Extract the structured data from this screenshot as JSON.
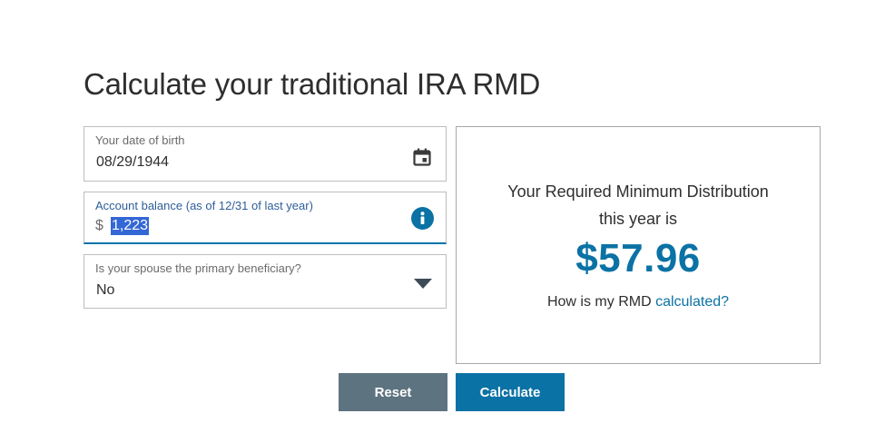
{
  "page": {
    "title": "Calculate your traditional IRA RMD"
  },
  "form": {
    "dob": {
      "label": "Your date of birth",
      "value": "08/29/1944",
      "icon": "calendar-icon"
    },
    "balance": {
      "label": "Account balance (as of 12/31 of last year)",
      "currency_symbol": "$",
      "value": "1,223",
      "value_selected": true,
      "icon": "info-icon"
    },
    "spouse": {
      "label": "Is your spouse the primary beneficiary?",
      "value": "No",
      "icon": "chevron-down-icon"
    }
  },
  "result": {
    "heading_line1": "Your Required Minimum Distribution",
    "heading_line2": "this year is",
    "amount": "$57.96",
    "link_prefix": "How is my RMD ",
    "link_text": "calculated?"
  },
  "buttons": {
    "reset_label": "Reset",
    "calculate_label": "Calculate"
  },
  "colors": {
    "accent": "#0b72a5",
    "reset_button": "#5e7380",
    "selection": "#3367d6",
    "focus_border": "#0073a8"
  }
}
